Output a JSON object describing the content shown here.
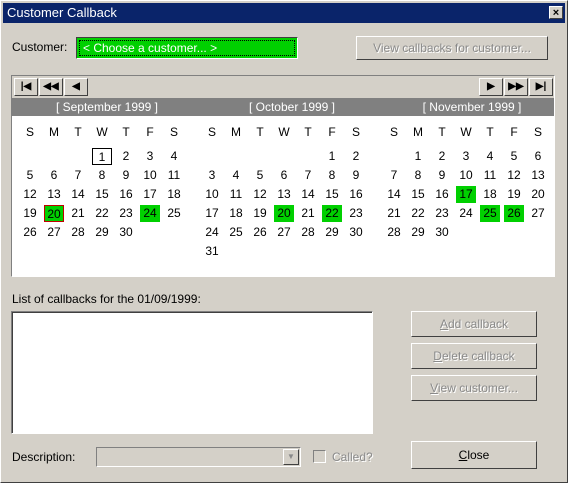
{
  "window": {
    "title": "Customer Callback",
    "close_glyph": "×"
  },
  "customer": {
    "label": "Customer:",
    "value": "< Choose a customer... >",
    "view_button": "View callbacks for customer..."
  },
  "nav": {
    "first": "⏮",
    "prev_fast": "◀◀",
    "prev": "◀",
    "next": "▶",
    "next_fast": "▶▶",
    "last": "⏭"
  },
  "dow": [
    "S",
    "M",
    "T",
    "W",
    "T",
    "F",
    "S"
  ],
  "months": [
    {
      "title": "[ September 1999 ]",
      "start": 3,
      "days": 30,
      "highlight": [
        20,
        24
      ],
      "selected": 20,
      "today": 1
    },
    {
      "title": "[ October 1999 ]",
      "start": 5,
      "days": 31,
      "highlight": [
        20,
        22
      ],
      "selected": null,
      "today": null
    },
    {
      "title": "[ November 1999 ]",
      "start": 1,
      "days": 30,
      "highlight": [
        17,
        25,
        26
      ],
      "selected": null,
      "today": null
    }
  ],
  "list": {
    "label": "List of callbacks for the 01/09/1999:"
  },
  "buttons": {
    "add": {
      "accel": "A",
      "rest": "dd callback"
    },
    "delete": {
      "accel": "D",
      "rest": "elete callback"
    },
    "view_customer": {
      "accel": "V",
      "rest": "iew customer..."
    },
    "close": {
      "accel": "C",
      "rest": "lose"
    }
  },
  "description": {
    "label": "Description:",
    "value": ""
  },
  "called": {
    "label": "Called?"
  },
  "colors": {
    "highlight": "#00d000",
    "titlebar": "#0a246a",
    "selected_border": "#c00000"
  }
}
